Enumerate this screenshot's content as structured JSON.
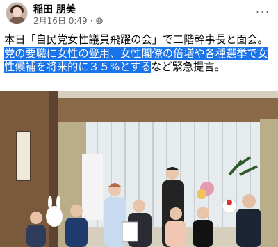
{
  "post": {
    "author": "稲田 朋美",
    "timestamp": "2月16日 0:49",
    "dot": "·",
    "text_line1": "本日「自民党女性議員飛躍の会」で二階幹事長と面会。",
    "highlighted": "党の要職に女性の登用、女性閣僚の倍増や各種選挙で女性候補を将来的に３５%とする",
    "text_tail": "など緊急提言。"
  },
  "actions": {
    "more_label": "···"
  },
  "icons": {
    "privacy": "globe-icon",
    "more": "more-horizontal-icon"
  },
  "colors": {
    "highlight": "#1a73e8",
    "meta_text": "#65676b"
  }
}
